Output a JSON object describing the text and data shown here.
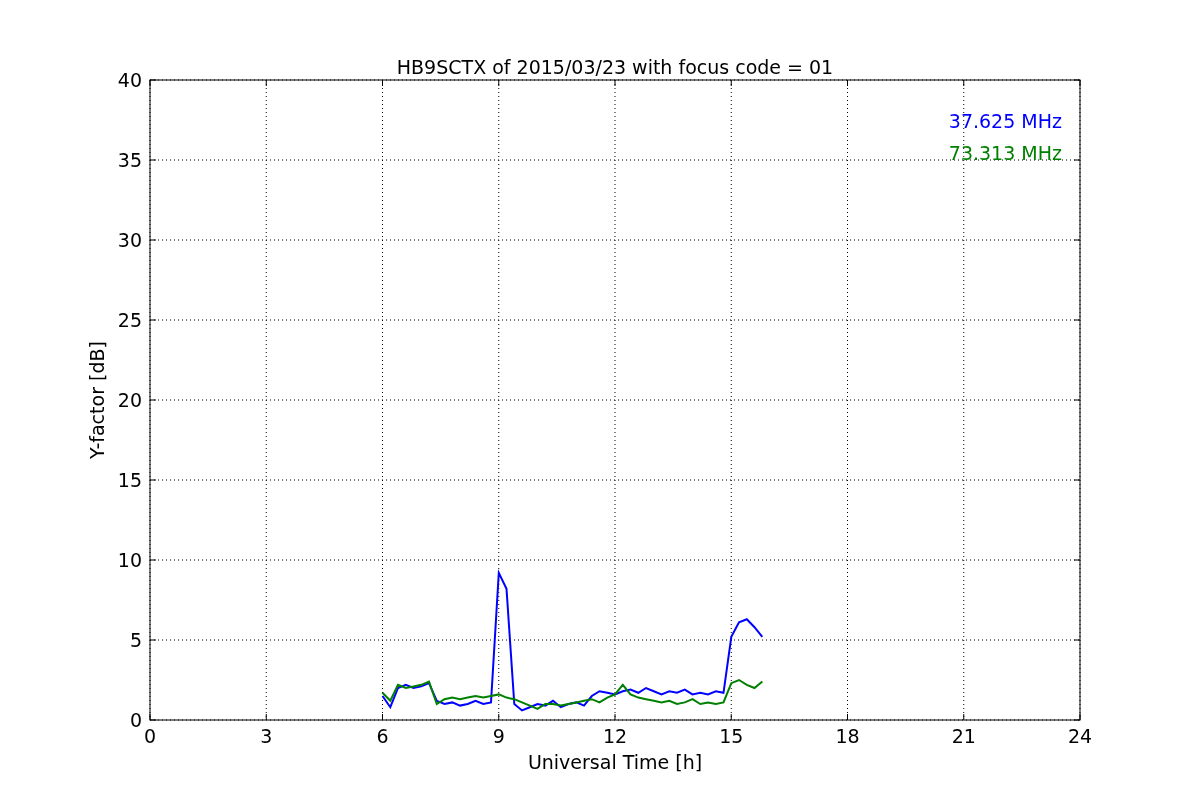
{
  "figure": {
    "chart_data": {
      "type": "line",
      "title": "HB9SCTX of 2015/03/23 with focus code = 01",
      "xlabel": "Universal Time [h]",
      "ylabel": "Y-factor [dB]",
      "x": [
        6.0,
        6.2,
        6.4,
        6.6,
        6.8,
        7.0,
        7.2,
        7.4,
        7.6,
        7.8,
        8.0,
        8.2,
        8.4,
        8.6,
        8.8,
        9.0,
        9.2,
        9.4,
        9.6,
        9.8,
        10.0,
        10.2,
        10.4,
        10.6,
        10.8,
        11.0,
        11.2,
        11.4,
        11.6,
        11.8,
        12.0,
        12.2,
        12.4,
        12.6,
        12.8,
        13.0,
        13.2,
        13.4,
        13.6,
        13.8,
        14.0,
        14.2,
        14.4,
        14.6,
        14.8,
        15.0,
        15.2,
        15.4,
        15.6,
        15.8
      ],
      "series": [
        {
          "name": "37.625 MHz",
          "color": "#0000ff",
          "values": [
            1.5,
            0.8,
            2.0,
            2.2,
            2.0,
            2.1,
            2.3,
            1.2,
            1.0,
            1.1,
            0.9,
            1.0,
            1.2,
            1.0,
            1.1,
            9.2,
            8.2,
            1.0,
            0.6,
            0.8,
            1.0,
            0.9,
            1.2,
            0.8,
            1.0,
            1.1,
            0.9,
            1.5,
            1.8,
            1.7,
            1.6,
            1.8,
            1.9,
            1.7,
            2.0,
            1.8,
            1.6,
            1.8,
            1.7,
            1.9,
            1.6,
            1.7,
            1.6,
            1.8,
            1.7,
            5.2,
            6.1,
            6.3,
            5.8,
            5.2
          ]
        },
        {
          "name": "73.313 MHz",
          "color": "#008000",
          "values": [
            1.7,
            1.2,
            2.2,
            2.0,
            2.1,
            2.2,
            2.4,
            1.0,
            1.3,
            1.4,
            1.3,
            1.4,
            1.5,
            1.4,
            1.5,
            1.6,
            1.4,
            1.3,
            1.1,
            0.9,
            0.7,
            1.0,
            1.0,
            0.9,
            1.0,
            1.1,
            1.2,
            1.3,
            1.1,
            1.4,
            1.6,
            2.2,
            1.6,
            1.4,
            1.3,
            1.2,
            1.1,
            1.2,
            1.0,
            1.1,
            1.3,
            1.0,
            1.1,
            1.0,
            1.1,
            2.3,
            2.5,
            2.2,
            2.0,
            2.4
          ]
        }
      ],
      "grid": true,
      "xlim": [
        0,
        24
      ],
      "ylim": [
        0,
        40
      ],
      "xticks": [
        0,
        3,
        6,
        9,
        12,
        15,
        18,
        21,
        24
      ],
      "yticks": [
        0,
        5,
        10,
        15,
        20,
        25,
        30,
        35,
        40
      ]
    }
  }
}
